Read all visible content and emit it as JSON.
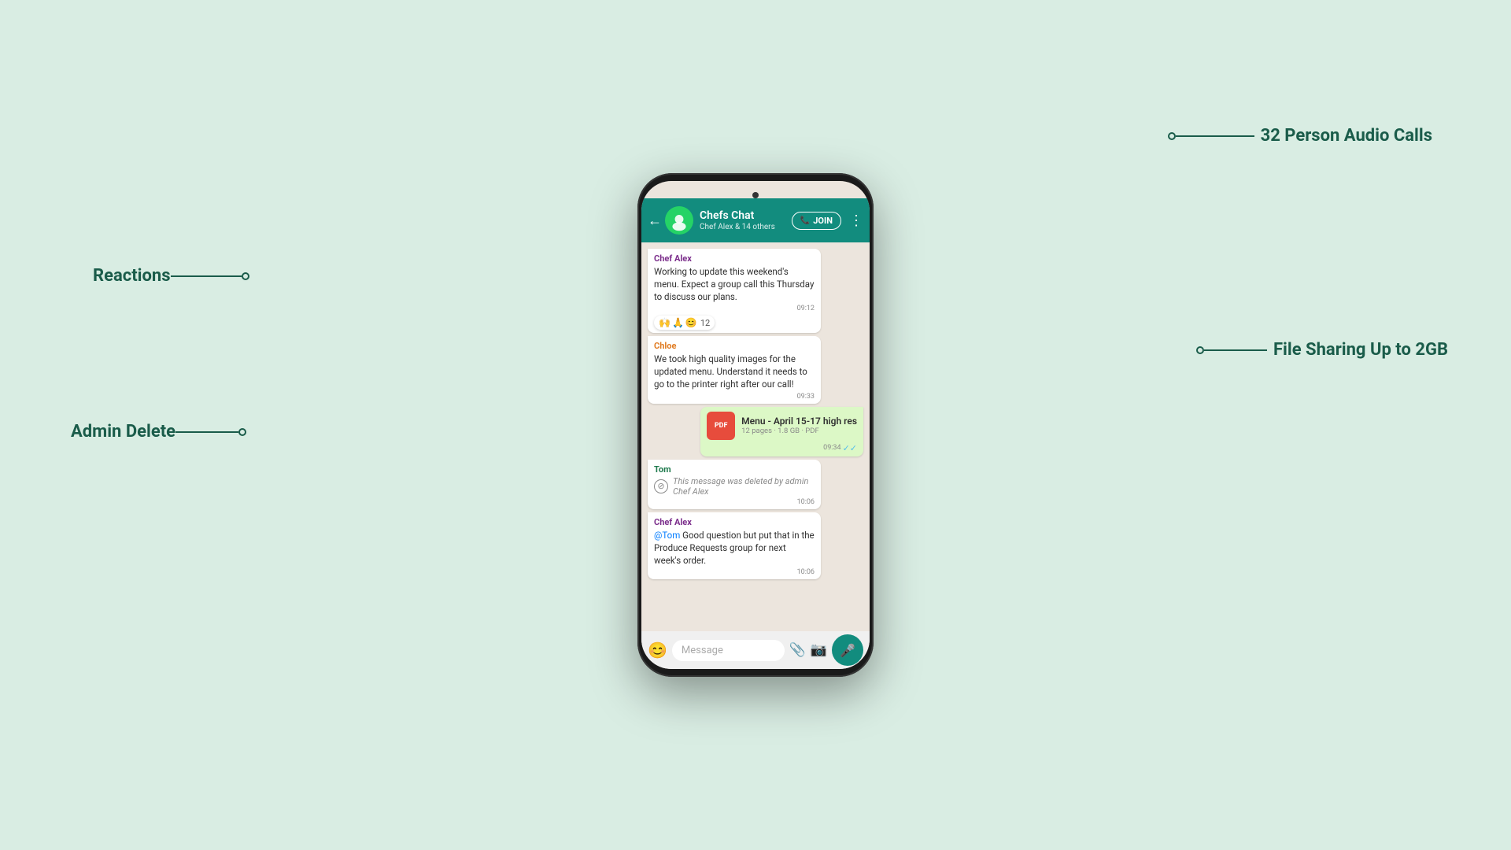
{
  "background_color": "#d9ede3",
  "phone": {
    "camera_dot": true
  },
  "header": {
    "back_icon": "←",
    "group_name": "Chefs Chat",
    "group_sub": "Chef Alex & 14 others",
    "call_icon": "📞",
    "join_label": "JOIN",
    "more_icon": "⋮"
  },
  "messages": [
    {
      "id": "msg1",
      "type": "received",
      "sender": "Chef Alex",
      "sender_class": "chef-alex",
      "text": "Working to update this weekend's menu. Expect a group call this Thursday to discuss our plans.",
      "time": "09:12",
      "reactions": [
        "🙌",
        "🙏",
        "😊",
        "12"
      ]
    },
    {
      "id": "msg2",
      "type": "received",
      "sender": "Chloe",
      "sender_class": "chloe",
      "text": "We took high quality images for the updated menu. Understand it needs to go to the printer right after our call!",
      "time": "09:33"
    },
    {
      "id": "msg3",
      "type": "sent",
      "file": true,
      "file_icon": "PDF",
      "file_name": "Menu - April 15-17 high res",
      "file_meta": "12 pages · 1.8 GB · PDF",
      "time": "09:34",
      "tick": "✓✓"
    },
    {
      "id": "msg4",
      "type": "received",
      "sender": "Tom",
      "sender_class": "tom",
      "deleted": true,
      "deleted_text": "This message was deleted by admin Chef Alex",
      "time": "10:06"
    },
    {
      "id": "msg5",
      "type": "received",
      "sender": "Chef Alex",
      "sender_class": "chef-alex",
      "text_parts": [
        {
          "mention": false,
          "text": ""
        },
        {
          "mention": true,
          "text": "@Tom"
        },
        {
          "mention": false,
          "text": " Good question but put that in the Produce Requests group for next week's order."
        }
      ],
      "time": "10:06"
    }
  ],
  "input": {
    "placeholder": "Message",
    "emoji_icon": "😊",
    "attach_icon": "📎",
    "camera_icon": "📷",
    "mic_icon": "🎤"
  },
  "annotations": {
    "reactions": "Reactions",
    "admin_delete": "Admin Delete",
    "audio_calls": "32 Person Audio Calls",
    "file_sharing": "File Sharing Up to 2GB"
  }
}
